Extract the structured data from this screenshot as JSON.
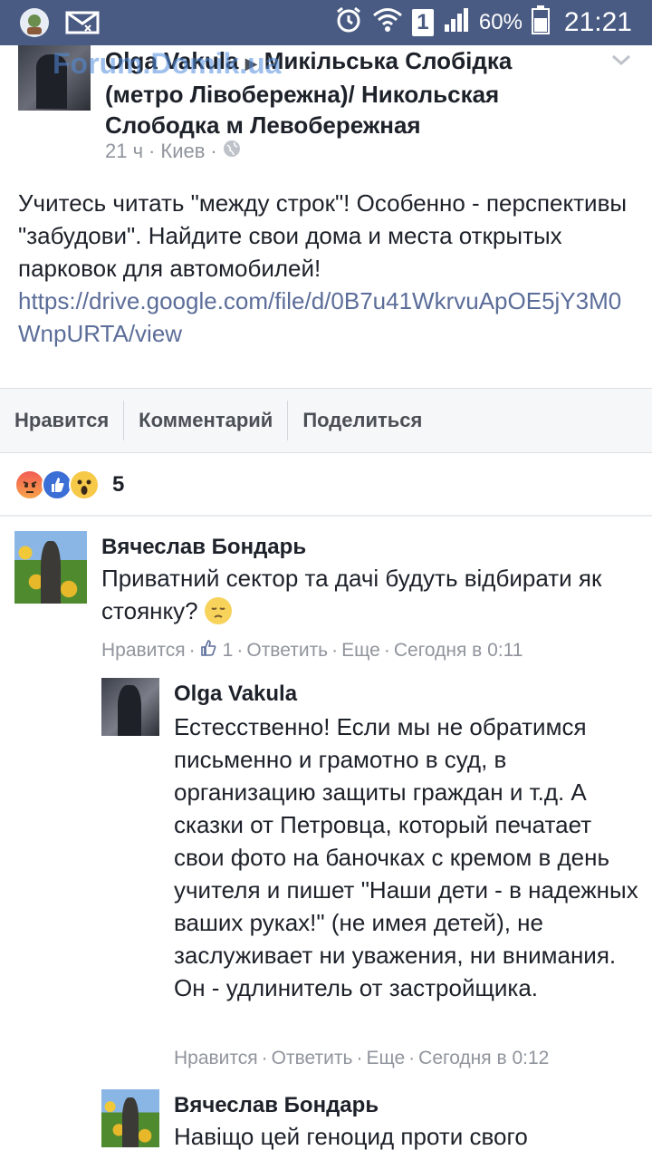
{
  "status_bar": {
    "battery_percent": "60%",
    "time": "21:21",
    "sim_slot": "1",
    "accent": "#4a5b83"
  },
  "post": {
    "author": "Olga Vakula",
    "arrow": "▶",
    "group_line1": "Микільська Слобідка",
    "group_line2": "(метро Лівобережна)/ Никольская",
    "group_line3": "Слободка м Левобережная",
    "watermark": "Forum.Domik.ua",
    "time": "21 ч",
    "location": "Киев",
    "body": "Учитесь читать \"между строк\"! Особенно - перспективы \"забудови\". Найдите свои дома и места открытых парковок для автомобилей!",
    "link": "https://drive.google.com/file/d/0B7u41WkrvuApOE5jY3M0WnpURTA/view"
  },
  "actions": {
    "like": "Нравится",
    "comment": "Комментарий",
    "share": "Поделиться"
  },
  "reactions": {
    "count": "5",
    "types": [
      "angry",
      "like",
      "wow"
    ]
  },
  "comments": [
    {
      "author": "Вячеслав Бондарь",
      "text": "Приватний сектор та дачі будуть відбирати як стоянку?",
      "like_label": "Нравится",
      "like_count": "1",
      "reply_label": "Ответить",
      "more_label": "Еще",
      "time": "Сегодня в 0:11"
    },
    {
      "author": "Olga Vakula",
      "text": "Естесственно! Если мы не обратимся письменно и грамотно в суд, в организацию защиты граждан и т.д. А сказки от Петровца, который печатает свои фото на баночках с кремом в день учителя и пишет \"Наши дети - в надежных ваших руках!\" (не имея детей), не заслуживает ни уважения, ни внимания. Он - удлинитель от застройщика.",
      "like_label": "Нравится",
      "reply_label": "Ответить",
      "more_label": "Еще",
      "time": "Сегодня в 0:12"
    },
    {
      "author": "Вячеслав Бондарь",
      "text": "Навіщо цей геноцид проти свого"
    }
  ]
}
